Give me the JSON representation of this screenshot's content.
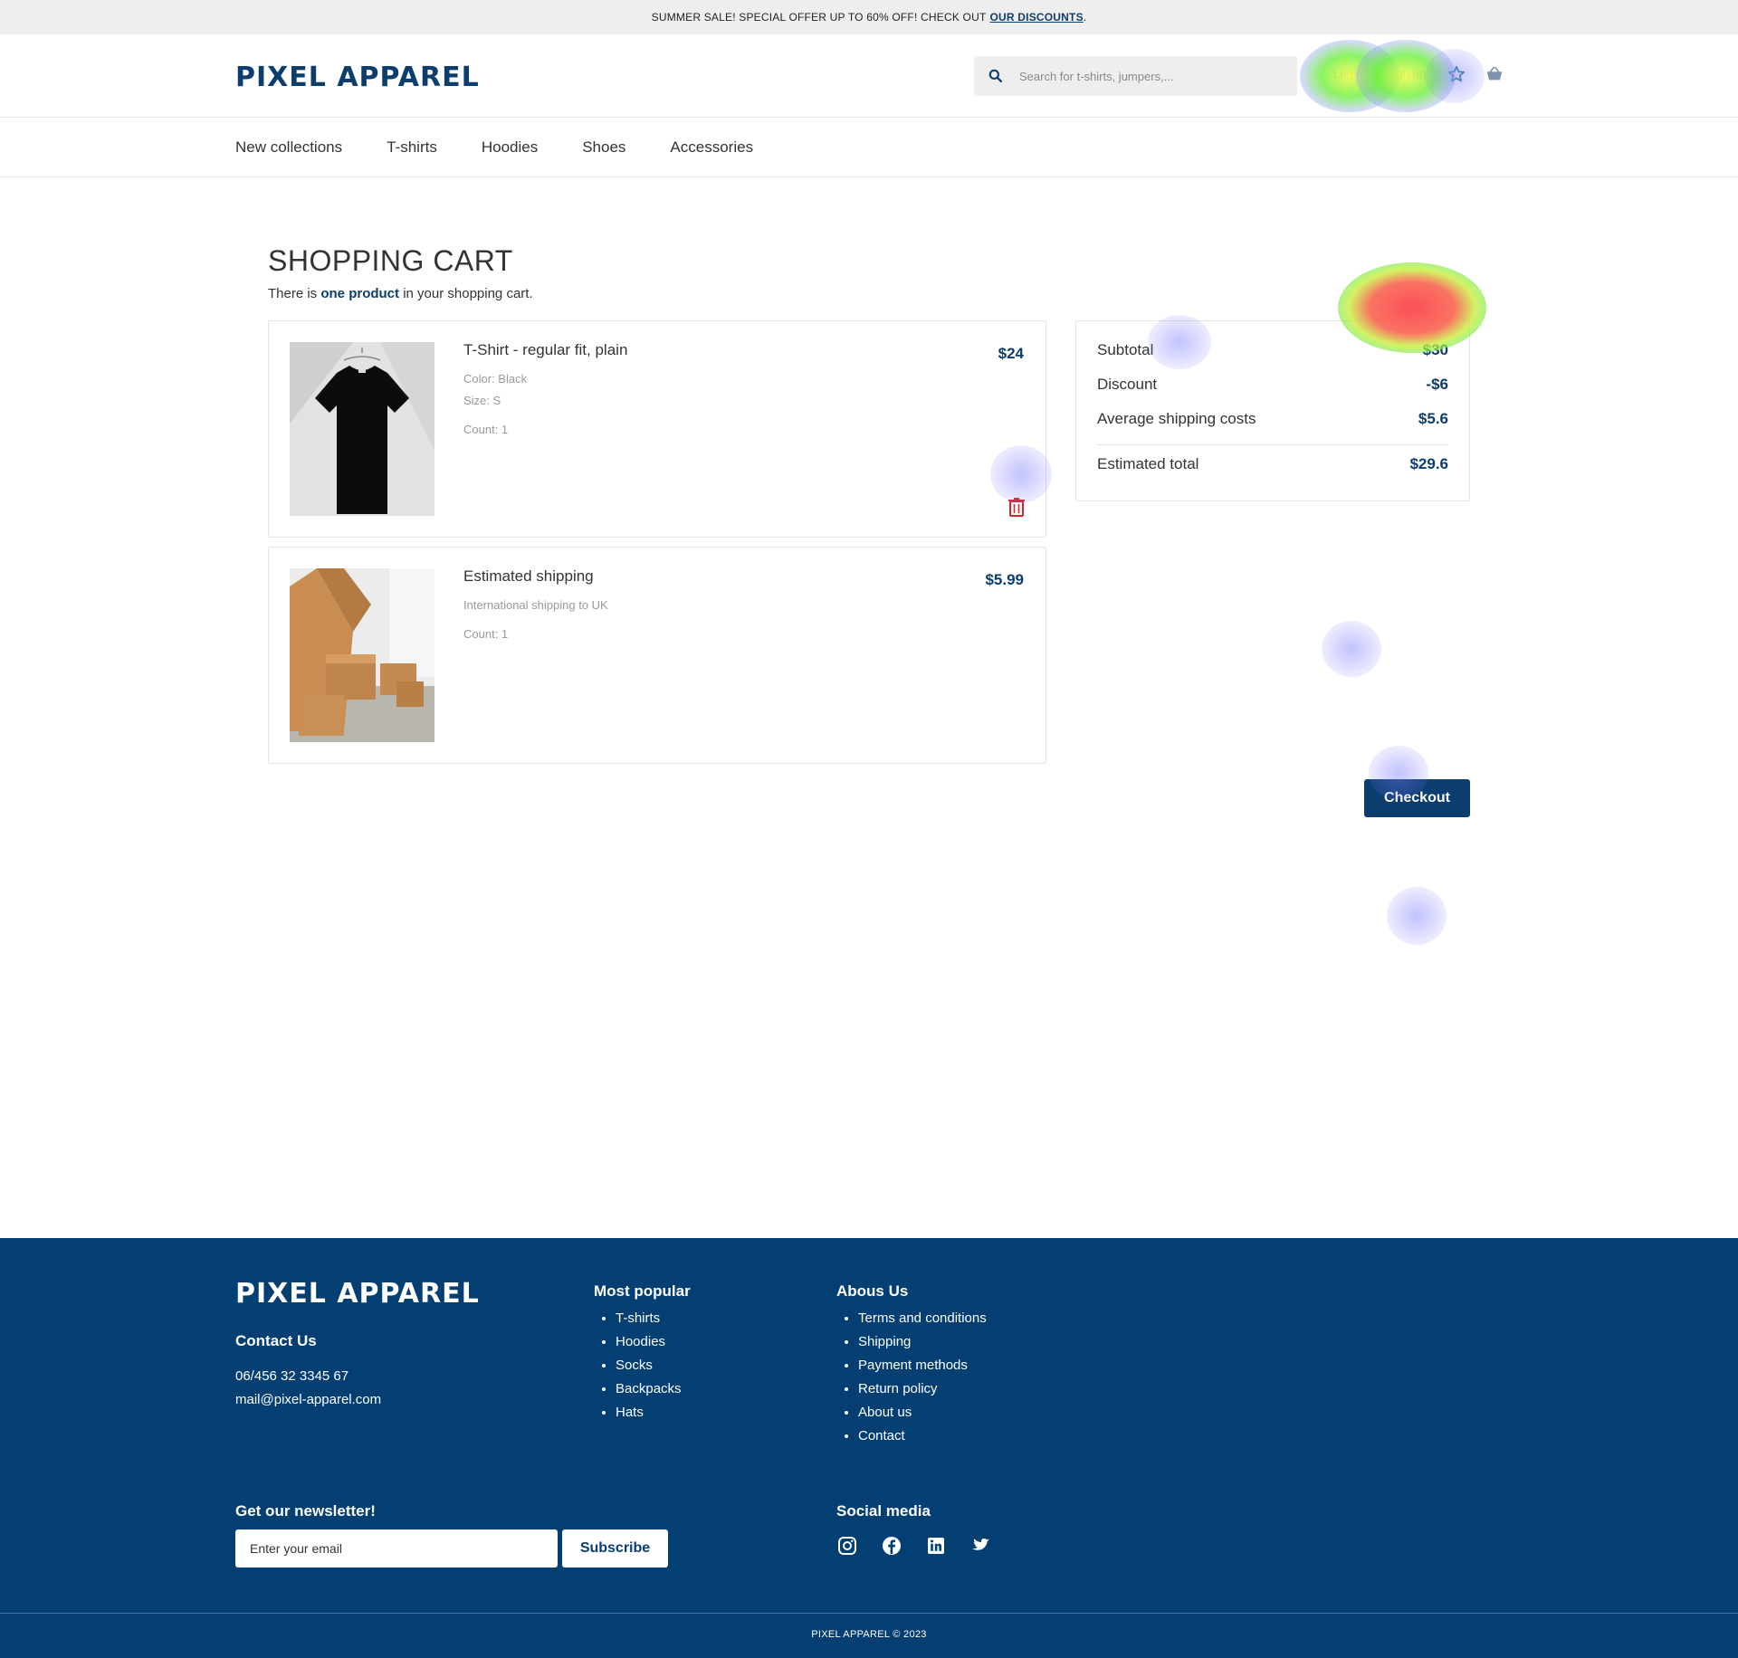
{
  "promo": {
    "text": "SUMMER SALE! SPECIAL OFFER UP TO 60% OFF! CHECK OUT",
    "link": "OUR DISCOUNTS",
    "end": "."
  },
  "header": {
    "logo": "PIXEL APPAREL",
    "search_placeholder": "Search for t-shirts, jumpers,...",
    "login": "Login",
    "signup": "Sign up",
    "icons": [
      "search-icon",
      "star-icon",
      "basket-icon"
    ]
  },
  "nav": {
    "items": [
      "New collections",
      "T-shirts",
      "Hoodies",
      "Shoes",
      "Accessories"
    ]
  },
  "cart": {
    "title": "SHOPPING CART",
    "subtitle_pre": "There is",
    "subtitle_bold": "one product",
    "subtitle_post": "in your shopping cart.",
    "items": [
      {
        "name": "T-Shirt - regular fit, plain",
        "color": "Color: Black",
        "size": "Size: S",
        "count": "Count: 1",
        "price": "$24"
      },
      {
        "name": "Estimated shipping",
        "detail": "International shipping to UK",
        "count": "Count: 1",
        "price": "$5.99"
      }
    ]
  },
  "summary": {
    "subtotal_label": "Subtotal",
    "subtotal_value": "$30",
    "discount_label": "Discount",
    "discount_value": "-$6",
    "shipping_label": "Average shipping costs",
    "shipping_value": "$5.6",
    "total_label": "Estimated total",
    "total_value": "$29.6"
  },
  "checkout": {
    "label": "Checkout"
  },
  "footer": {
    "logo": "PIXEL APPAREL",
    "contact_heading": "Contact Us",
    "phone": "06/456 32 3345 67",
    "email": "mail@pixel-apparel.com",
    "popular_heading": "Most popular",
    "popular": [
      "T-shirts",
      "Hoodies",
      "Socks",
      "Backpacks",
      "Hats"
    ],
    "about_heading": "Abous Us",
    "about": [
      "Terms and conditions",
      "Shipping",
      "Payment methods",
      "Return policy",
      "About us",
      "Contact"
    ],
    "newsletter_heading": "Get our newsletter!",
    "email_placeholder": "Enter your email",
    "subscribe": "Subscribe",
    "social_heading": "Social media",
    "social_icons": [
      "instagram-icon",
      "facebook-icon",
      "linkedin-icon",
      "twitter-icon"
    ],
    "copyright": "PIXEL APPAREL © 2023"
  },
  "colors": {
    "brand": "#0b3d6e",
    "footer_bg": "#033f73",
    "danger": "#d9262c"
  }
}
